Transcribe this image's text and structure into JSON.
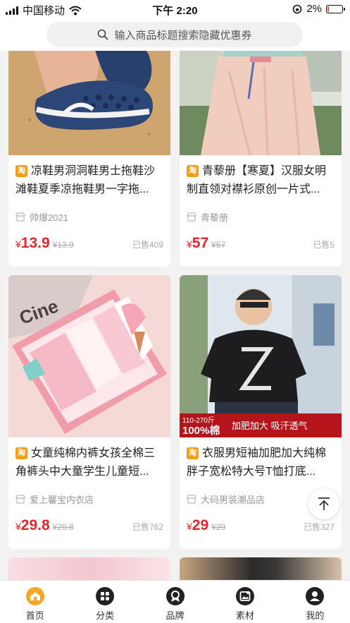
{
  "status_bar": {
    "carrier": "中国移动",
    "time": "下午 2:20",
    "battery": "2%",
    "battery_level": 0.02
  },
  "search": {
    "placeholder": "输入商品标题搜索隐藏优惠券"
  },
  "products": [
    {
      "title": "凉鞋男洞洞鞋男士拖鞋沙滩鞋夏季凉拖鞋男一字拖...",
      "shop": "帅爆2021",
      "currency": "¥",
      "price": "13.9",
      "orig_price": "¥13.9",
      "sold": "已售409"
    },
    {
      "title": "青藜册【寒夏】汉服女明制直领对襟衫原创一片式...",
      "shop": "青藜册",
      "currency": "¥",
      "price": "57",
      "orig_price": "¥57",
      "sold": "已售5"
    },
    {
      "title": "女童纯棉内裤女孩全棉三角裤头中大童学生儿童短...",
      "shop": "爱上馨宝内衣店",
      "currency": "¥",
      "price": "29.8",
      "orig_price": "¥29.8",
      "sold": "已售762",
      "image_text": "Cine"
    },
    {
      "title": "衣服男短袖加肥加大纯棉胖子宽松特大号T恤打底...",
      "shop": "大码男装潮品店",
      "currency": "¥",
      "price": "29",
      "orig_price": "¥29",
      "sold": "已售327",
      "banner_weight": "110-270斤",
      "banner_material": "100%棉",
      "banner_features": "加肥加大 吸汗透气"
    }
  ],
  "taobao_badge": "淘",
  "tabs": [
    {
      "label": "首页",
      "icon": "home-icon",
      "active": true
    },
    {
      "label": "分类",
      "icon": "category-icon"
    },
    {
      "label": "品牌",
      "icon": "brand-icon"
    },
    {
      "label": "素材",
      "icon": "material-icon"
    },
    {
      "label": "我的",
      "icon": "profile-icon"
    }
  ],
  "colors": {
    "price_red": "#e5252a",
    "badge_orange": "#f39d1b",
    "home_active": "#f5a623"
  }
}
